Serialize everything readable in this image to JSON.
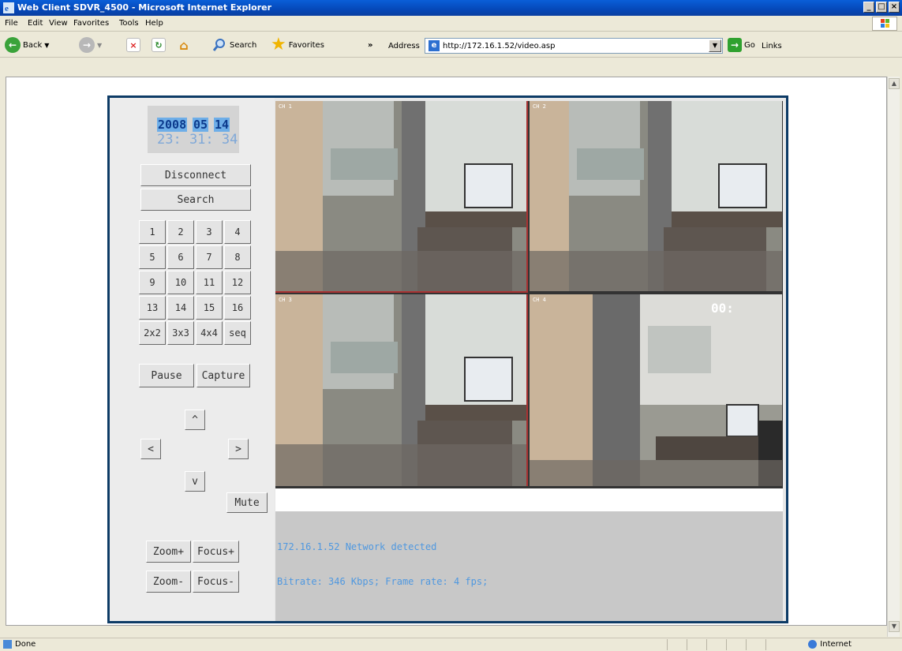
{
  "window": {
    "title": "Web Client SDVR_4500 - Microsoft Internet Explorer",
    "controls": [
      "_",
      "□",
      "×"
    ]
  },
  "menu": [
    "File",
    "Edit",
    "View",
    "Favorites",
    "Tools",
    "Help"
  ],
  "toolbar": {
    "back": "Back",
    "search": "Search",
    "favorites": "Favorites",
    "chevron": "»",
    "address_label": "Address",
    "address_value": "http://172.16.1.52/video.asp",
    "go": "Go",
    "links": "Links"
  },
  "dvr": {
    "date": {
      "year": "2008",
      "month": "05",
      "day": "14"
    },
    "time": "23: 31: 34",
    "disconnect": "Disconnect",
    "search": "Search",
    "channels": [
      "1",
      "2",
      "3",
      "4",
      "5",
      "6",
      "7",
      "8",
      "9",
      "10",
      "11",
      "12",
      "13",
      "14",
      "15",
      "16"
    ],
    "layouts": [
      "2x2",
      "3x3",
      "4x4",
      "seq"
    ],
    "pause": "Pause",
    "capture": "Capture",
    "ptz": {
      "up": "^",
      "left": "<",
      "right": ">",
      "down": "v"
    },
    "mute": "Mute",
    "zoom_in": "Zoom+",
    "focus_in": "Focus+",
    "zoom_out": "Zoom-",
    "focus_out": "Focus-",
    "cameras": [
      {
        "label": "CH 1",
        "osd": ""
      },
      {
        "label": "CH 2",
        "osd": ""
      },
      {
        "label": "CH 3",
        "osd": ""
      },
      {
        "label": "CH 4",
        "osd": "00:"
      }
    ],
    "status_line1": "172.16.1.52 Network detected",
    "status_line2": "Bitrate: 346 Kbps; Frame rate: 4 fps;"
  },
  "statusbar": {
    "left": "Done",
    "zone": "Internet"
  }
}
